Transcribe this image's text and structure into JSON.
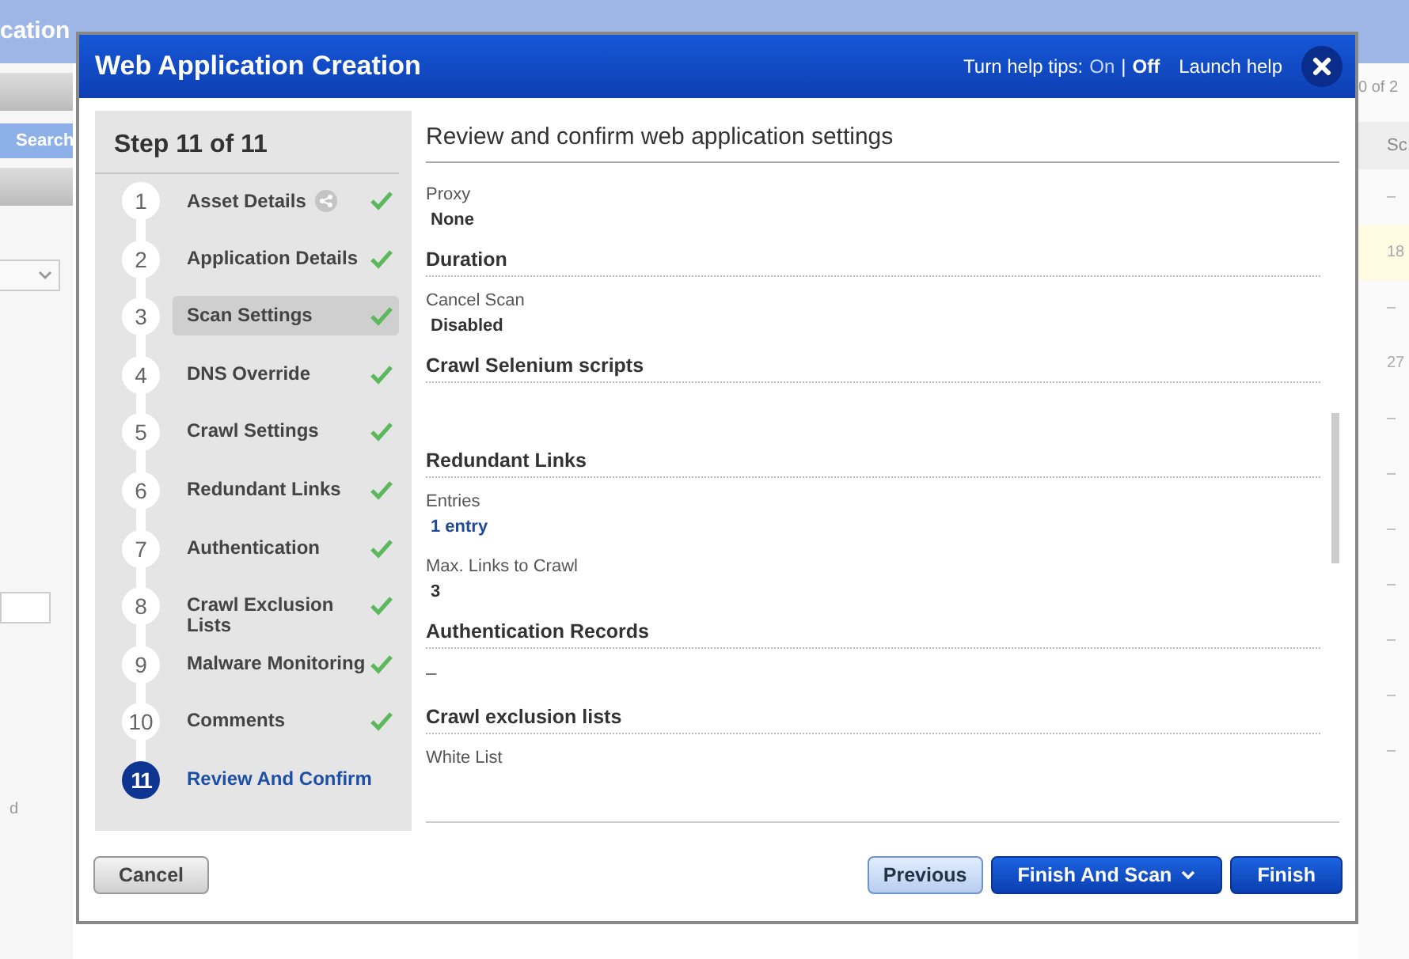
{
  "background": {
    "app_title": "cation",
    "search_button": "Search",
    "pager": "0 of 2",
    "column_header": "Sc",
    "column_values": [
      {
        "text": "–",
        "highlighted": false
      },
      {
        "text": "18",
        "highlighted": true
      },
      {
        "text": "–",
        "highlighted": false
      },
      {
        "text": "27",
        "highlighted": false
      },
      {
        "text": "–",
        "highlighted": false
      },
      {
        "text": "–",
        "highlighted": false
      },
      {
        "text": "–",
        "highlighted": false
      },
      {
        "text": "–",
        "highlighted": false
      },
      {
        "text": "–",
        "highlighted": false
      },
      {
        "text": "–",
        "highlighted": false
      },
      {
        "text": "–",
        "highlighted": false
      }
    ],
    "footer_letter": "d"
  },
  "dialog": {
    "title": "Web Application Creation",
    "help_tips_label": "Turn help tips:",
    "help_tips_separator": "|",
    "help_tips_options": [
      {
        "label": "On",
        "selected": false
      },
      {
        "label": "Off",
        "selected": true
      }
    ],
    "launch_help": "Launch help",
    "step_header": "Step 11 of 11",
    "steps": [
      {
        "number": "1",
        "label": "Asset Details",
        "info": true,
        "completed": true,
        "highlighted": false,
        "current": false
      },
      {
        "number": "2",
        "label": "Application Details",
        "info": false,
        "completed": true,
        "highlighted": false,
        "current": false
      },
      {
        "number": "3",
        "label": "Scan Settings",
        "info": false,
        "completed": true,
        "highlighted": true,
        "current": false
      },
      {
        "number": "4",
        "label": "DNS Override",
        "info": false,
        "completed": true,
        "highlighted": false,
        "current": false
      },
      {
        "number": "5",
        "label": "Crawl Settings",
        "info": false,
        "completed": true,
        "highlighted": false,
        "current": false
      },
      {
        "number": "6",
        "label": "Redundant Links",
        "info": false,
        "completed": true,
        "highlighted": false,
        "current": false
      },
      {
        "number": "7",
        "label": "Authentication",
        "info": false,
        "completed": true,
        "highlighted": false,
        "current": false
      },
      {
        "number": "8",
        "label": "Crawl Exclusion Lists",
        "info": false,
        "completed": true,
        "highlighted": false,
        "current": false
      },
      {
        "number": "9",
        "label": "Malware Monitoring",
        "info": false,
        "completed": true,
        "highlighted": false,
        "current": false
      },
      {
        "number": "10",
        "label": "Comments",
        "info": false,
        "completed": true,
        "highlighted": false,
        "current": false
      },
      {
        "number": "11",
        "label": "Review And Confirm",
        "info": false,
        "completed": false,
        "highlighted": false,
        "current": true
      }
    ],
    "content_title": "Review and confirm web application settings",
    "items": [
      {
        "kind": "field",
        "label": "Proxy",
        "value": "None",
        "link": false
      },
      {
        "kind": "heading",
        "text": "Duration"
      },
      {
        "kind": "field",
        "label": "Cancel Scan",
        "value": "Disabled",
        "link": false
      },
      {
        "kind": "heading",
        "text": "Crawl Selenium scripts"
      },
      {
        "kind": "empty"
      },
      {
        "kind": "heading",
        "text": "Redundant Links"
      },
      {
        "kind": "field",
        "label": "Entries",
        "value": "1 entry",
        "link": true
      },
      {
        "kind": "field",
        "label": "Max. Links to Crawl",
        "value": "3",
        "link": false
      },
      {
        "kind": "heading",
        "text": "Authentication Records"
      },
      {
        "kind": "dash",
        "text": "–"
      },
      {
        "kind": "heading",
        "text": "Crawl exclusion lists"
      },
      {
        "kind": "label",
        "text": "White List"
      }
    ],
    "buttons": [
      {
        "label": "Cancel",
        "kind": "secondary",
        "dropdown": false
      },
      {
        "label": "Previous",
        "kind": "light",
        "dropdown": false
      },
      {
        "label": "Finish And Scan",
        "kind": "primary",
        "dropdown": true
      },
      {
        "label": "Finish",
        "kind": "primary",
        "dropdown": false
      }
    ]
  }
}
